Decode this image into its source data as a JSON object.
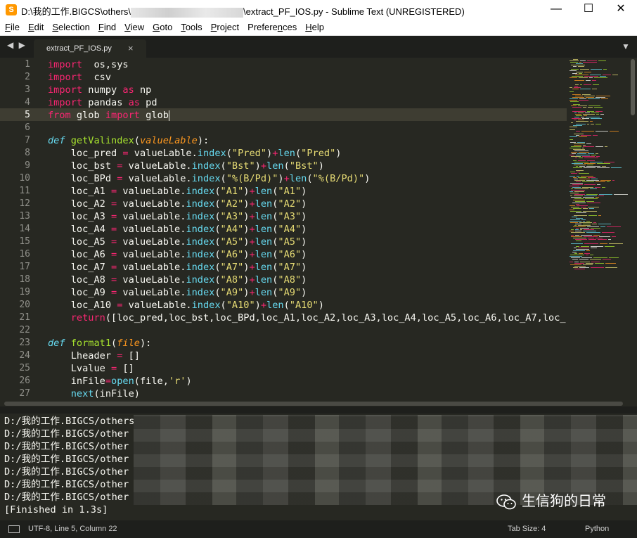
{
  "window": {
    "title_prefix": "D:\\我的工作.BIGCS\\others\\",
    "title_suffix": "\\extract_PF_IOS.py - Sublime Text (UNREGISTERED)",
    "app_icon_glyph": "S"
  },
  "window_controls": {
    "minimize": "—",
    "maximize": "☐",
    "close": "✕"
  },
  "menu": [
    {
      "key": "F",
      "rest": "ile"
    },
    {
      "key": "E",
      "rest": "dit"
    },
    {
      "key": "S",
      "rest": "election"
    },
    {
      "key": "F",
      "rest": "ind"
    },
    {
      "key": "V",
      "rest": "iew"
    },
    {
      "key": "G",
      "rest": "oto"
    },
    {
      "key": "T",
      "rest": "ools"
    },
    {
      "key": "P",
      "rest": "roject"
    },
    {
      "key": "P",
      "rest": "references",
      "pre": "Prefere",
      "key2": "n",
      "post": "ces"
    },
    {
      "key": "H",
      "rest": "elp"
    }
  ],
  "tabs": {
    "nav": "◀ ▶",
    "active": {
      "label": "extract_PF_IOS.py",
      "close": "×"
    },
    "dropdown": "▼"
  },
  "editor": {
    "current_line": 5,
    "lines": [
      {
        "n": "1",
        "t": [
          [
            "kw",
            "import"
          ],
          [
            "",
            "  os,sys"
          ]
        ]
      },
      {
        "n": "2",
        "t": [
          [
            "kw",
            "import"
          ],
          [
            "",
            "  csv"
          ]
        ]
      },
      {
        "n": "3",
        "t": [
          [
            "kw",
            "import"
          ],
          [
            "",
            " numpy "
          ],
          [
            "kw",
            "as"
          ],
          [
            "",
            " np"
          ]
        ]
      },
      {
        "n": "4",
        "t": [
          [
            "kw",
            "import"
          ],
          [
            "",
            " pandas "
          ],
          [
            "kw",
            "as"
          ],
          [
            "",
            " pd"
          ]
        ]
      },
      {
        "n": "5",
        "t": [
          [
            "kw",
            "from"
          ],
          [
            "",
            " glob "
          ],
          [
            "kw",
            "import"
          ],
          [
            "",
            " glob"
          ]
        ]
      },
      {
        "n": "6",
        "t": []
      },
      {
        "n": "7",
        "t": [
          [
            "def",
            "def"
          ],
          [
            "",
            " "
          ],
          [
            "fn",
            "getValindex"
          ],
          [
            "",
            "("
          ],
          [
            "par",
            "valueLable"
          ],
          [
            "",
            "):"
          ]
        ]
      },
      {
        "n": "8",
        "t": [
          [
            "",
            "    loc_pred "
          ],
          [
            "kw",
            "="
          ],
          [
            "",
            " valueLable."
          ],
          [
            "bi",
            "index"
          ],
          [
            "",
            "("
          ],
          [
            "str",
            "\"Pred\""
          ],
          [
            "",
            ")"
          ],
          [
            "kw",
            "+"
          ],
          [
            "bi",
            "len"
          ],
          [
            "",
            "("
          ],
          [
            "str",
            "\"Pred\""
          ],
          [
            "",
            ")"
          ]
        ]
      },
      {
        "n": "9",
        "t": [
          [
            "",
            "    loc_bst "
          ],
          [
            "kw",
            "="
          ],
          [
            "",
            " valueLable."
          ],
          [
            "bi",
            "index"
          ],
          [
            "",
            "("
          ],
          [
            "str",
            "\"Bst\""
          ],
          [
            "",
            ")"
          ],
          [
            "kw",
            "+"
          ],
          [
            "bi",
            "len"
          ],
          [
            "",
            "("
          ],
          [
            "str",
            "\"Bst\""
          ],
          [
            "",
            ")"
          ]
        ]
      },
      {
        "n": "10",
        "t": [
          [
            "",
            "    loc_BPd "
          ],
          [
            "kw",
            "="
          ],
          [
            "",
            " valueLable."
          ],
          [
            "bi",
            "index"
          ],
          [
            "",
            "("
          ],
          [
            "str",
            "\"%(B/Pd)\""
          ],
          [
            "",
            ")"
          ],
          [
            "kw",
            "+"
          ],
          [
            "bi",
            "len"
          ],
          [
            "",
            "("
          ],
          [
            "str",
            "\"%(B/Pd)\""
          ],
          [
            "",
            ")"
          ]
        ]
      },
      {
        "n": "11",
        "t": [
          [
            "",
            "    loc_A1 "
          ],
          [
            "kw",
            "="
          ],
          [
            "",
            " valueLable."
          ],
          [
            "bi",
            "index"
          ],
          [
            "",
            "("
          ],
          [
            "str",
            "\"A1\""
          ],
          [
            "",
            ")"
          ],
          [
            "kw",
            "+"
          ],
          [
            "bi",
            "len"
          ],
          [
            "",
            "("
          ],
          [
            "str",
            "\"A1\""
          ],
          [
            "",
            ")"
          ]
        ]
      },
      {
        "n": "12",
        "t": [
          [
            "",
            "    loc_A2 "
          ],
          [
            "kw",
            "="
          ],
          [
            "",
            " valueLable."
          ],
          [
            "bi",
            "index"
          ],
          [
            "",
            "("
          ],
          [
            "str",
            "\"A2\""
          ],
          [
            "",
            ")"
          ],
          [
            "kw",
            "+"
          ],
          [
            "bi",
            "len"
          ],
          [
            "",
            "("
          ],
          [
            "str",
            "\"A2\""
          ],
          [
            "",
            ")"
          ]
        ]
      },
      {
        "n": "13",
        "t": [
          [
            "",
            "    loc_A3 "
          ],
          [
            "kw",
            "="
          ],
          [
            "",
            " valueLable."
          ],
          [
            "bi",
            "index"
          ],
          [
            "",
            "("
          ],
          [
            "str",
            "\"A3\""
          ],
          [
            "",
            ")"
          ],
          [
            "kw",
            "+"
          ],
          [
            "bi",
            "len"
          ],
          [
            "",
            "("
          ],
          [
            "str",
            "\"A3\""
          ],
          [
            "",
            ")"
          ]
        ]
      },
      {
        "n": "14",
        "t": [
          [
            "",
            "    loc_A4 "
          ],
          [
            "kw",
            "="
          ],
          [
            "",
            " valueLable."
          ],
          [
            "bi",
            "index"
          ],
          [
            "",
            "("
          ],
          [
            "str",
            "\"A4\""
          ],
          [
            "",
            ")"
          ],
          [
            "kw",
            "+"
          ],
          [
            "bi",
            "len"
          ],
          [
            "",
            "("
          ],
          [
            "str",
            "\"A4\""
          ],
          [
            "",
            ")"
          ]
        ]
      },
      {
        "n": "15",
        "t": [
          [
            "",
            "    loc_A5 "
          ],
          [
            "kw",
            "="
          ],
          [
            "",
            " valueLable."
          ],
          [
            "bi",
            "index"
          ],
          [
            "",
            "("
          ],
          [
            "str",
            "\"A5\""
          ],
          [
            "",
            ")"
          ],
          [
            "kw",
            "+"
          ],
          [
            "bi",
            "len"
          ],
          [
            "",
            "("
          ],
          [
            "str",
            "\"A5\""
          ],
          [
            "",
            ")"
          ]
        ]
      },
      {
        "n": "16",
        "t": [
          [
            "",
            "    loc_A6 "
          ],
          [
            "kw",
            "="
          ],
          [
            "",
            " valueLable."
          ],
          [
            "bi",
            "index"
          ],
          [
            "",
            "("
          ],
          [
            "str",
            "\"A6\""
          ],
          [
            "",
            ")"
          ],
          [
            "kw",
            "+"
          ],
          [
            "bi",
            "len"
          ],
          [
            "",
            "("
          ],
          [
            "str",
            "\"A6\""
          ],
          [
            "",
            ")"
          ]
        ]
      },
      {
        "n": "17",
        "t": [
          [
            "",
            "    loc_A7 "
          ],
          [
            "kw",
            "="
          ],
          [
            "",
            " valueLable."
          ],
          [
            "bi",
            "index"
          ],
          [
            "",
            "("
          ],
          [
            "str",
            "\"A7\""
          ],
          [
            "",
            ")"
          ],
          [
            "kw",
            "+"
          ],
          [
            "bi",
            "len"
          ],
          [
            "",
            "("
          ],
          [
            "str",
            "\"A7\""
          ],
          [
            "",
            ")"
          ]
        ]
      },
      {
        "n": "18",
        "t": [
          [
            "",
            "    loc_A8 "
          ],
          [
            "kw",
            "="
          ],
          [
            "",
            " valueLable."
          ],
          [
            "bi",
            "index"
          ],
          [
            "",
            "("
          ],
          [
            "str",
            "\"A8\""
          ],
          [
            "",
            ")"
          ],
          [
            "kw",
            "+"
          ],
          [
            "bi",
            "len"
          ],
          [
            "",
            "("
          ],
          [
            "str",
            "\"A8\""
          ],
          [
            "",
            ")"
          ]
        ]
      },
      {
        "n": "19",
        "t": [
          [
            "",
            "    loc_A9 "
          ],
          [
            "kw",
            "="
          ],
          [
            "",
            " valueLable."
          ],
          [
            "bi",
            "index"
          ],
          [
            "",
            "("
          ],
          [
            "str",
            "\"A9\""
          ],
          [
            "",
            ")"
          ],
          [
            "kw",
            "+"
          ],
          [
            "bi",
            "len"
          ],
          [
            "",
            "("
          ],
          [
            "str",
            "\"A9\""
          ],
          [
            "",
            ")"
          ]
        ]
      },
      {
        "n": "20",
        "t": [
          [
            "",
            "    loc_A10 "
          ],
          [
            "kw",
            "="
          ],
          [
            "",
            " valueLable."
          ],
          [
            "bi",
            "index"
          ],
          [
            "",
            "("
          ],
          [
            "str",
            "\"A10\""
          ],
          [
            "",
            ")"
          ],
          [
            "kw",
            "+"
          ],
          [
            "bi",
            "len"
          ],
          [
            "",
            "("
          ],
          [
            "str",
            "\"A10\""
          ],
          [
            "",
            ")"
          ]
        ]
      },
      {
        "n": "21",
        "t": [
          [
            "",
            "    "
          ],
          [
            "kw",
            "return"
          ],
          [
            "",
            "([loc_pred,loc_bst,loc_BPd,loc_A1,loc_A2,loc_A3,loc_A4,loc_A5,loc_A6,loc_A7,loc_"
          ]
        ]
      },
      {
        "n": "22",
        "t": []
      },
      {
        "n": "23",
        "t": [
          [
            "def",
            "def"
          ],
          [
            "",
            " "
          ],
          [
            "fn",
            "format1"
          ],
          [
            "",
            "("
          ],
          [
            "par",
            "file"
          ],
          [
            "",
            "):"
          ]
        ]
      },
      {
        "n": "24",
        "t": [
          [
            "",
            "    Lheader "
          ],
          [
            "kw",
            "="
          ],
          [
            "",
            " []"
          ]
        ]
      },
      {
        "n": "25",
        "t": [
          [
            "",
            "    Lvalue "
          ],
          [
            "kw",
            "="
          ],
          [
            "",
            " []"
          ]
        ]
      },
      {
        "n": "26",
        "t": [
          [
            "",
            "    inFile"
          ],
          [
            "kw",
            "="
          ],
          [
            "bi",
            "open"
          ],
          [
            "",
            "(file,"
          ],
          [
            "str",
            "'r'"
          ],
          [
            "",
            ")"
          ]
        ]
      },
      {
        "n": "27",
        "t": [
          [
            "",
            "    "
          ],
          [
            "bi",
            "next"
          ],
          [
            "",
            "(inFile)"
          ]
        ]
      }
    ]
  },
  "output": {
    "lines": [
      "D:/我的工作.BIGCS/others",
      "D:/我的工作.BIGCS/other",
      "D:/我的工作.BIGCS/other",
      "D:/我的工作.BIGCS/other",
      "D:/我的工作.BIGCS/other",
      "D:/我的工作.BIGCS/other",
      "D:/我的工作.BIGCS/other",
      "[Finished in 1.3s]"
    ]
  },
  "watermark": {
    "text": "生信狗的日常"
  },
  "status": {
    "position": "UTF-8, Line 5, Column 22",
    "tab_size": "Tab Size: 4",
    "syntax": "Python"
  },
  "colors": {
    "background": "#272822",
    "keyword": "#f92672",
    "function": "#a6e22e",
    "string": "#e6db74",
    "builtin": "#66d9ef",
    "parameter": "#fd971f"
  }
}
